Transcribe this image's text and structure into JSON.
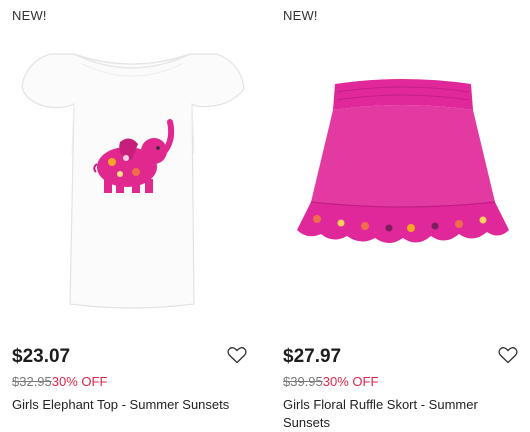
{
  "products": [
    {
      "badge": "NEW!",
      "price": "$23.07",
      "original_price": "$32.95",
      "discount": "30% OFF",
      "title": "Girls Elephant Top - Summer Sunsets",
      "image_icon": "elephant-top-image"
    },
    {
      "badge": "NEW!",
      "price": "$27.97",
      "original_price": "$39.95",
      "discount": "30% OFF",
      "title": "Girls Floral Ruffle Skort - Summer Sunsets",
      "image_icon": "skort-image"
    }
  ],
  "colors": {
    "discount": "#e0264b",
    "skort": "#e0289a",
    "elephant": "#e0288e"
  }
}
